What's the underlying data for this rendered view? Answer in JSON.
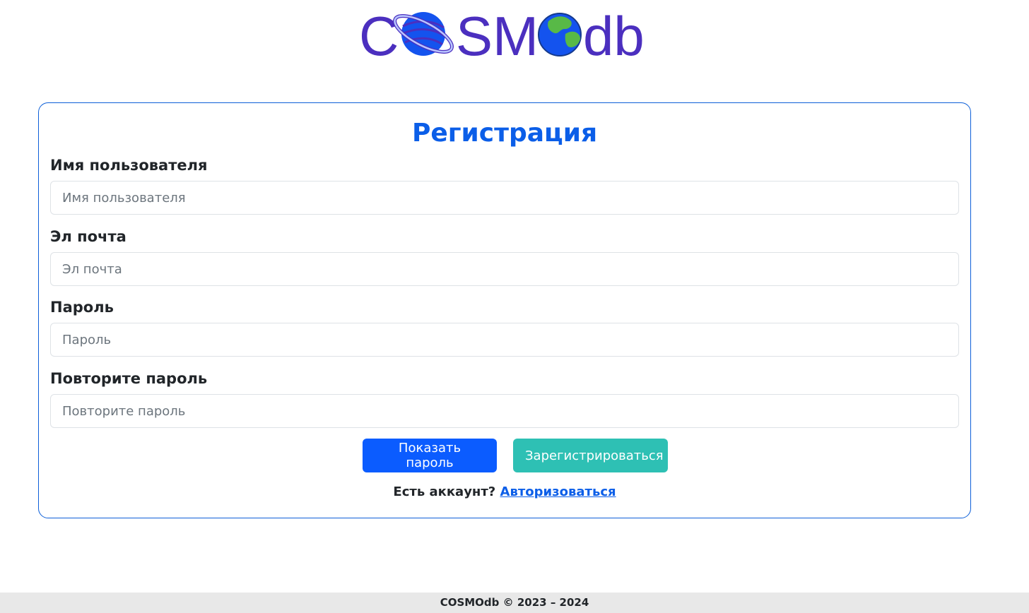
{
  "header": {
    "logo_text": "COSMOdb",
    "logo_color": "#4b2fbf",
    "logo_planet_color": "#1453ee",
    "logo_land_color": "#58b947"
  },
  "form": {
    "title": "Регистрация",
    "username_label": "Имя пользователя",
    "username_placeholder": "Имя пользователя",
    "email_label": "Эл почта",
    "email_placeholder": "Эл почта",
    "password_label": "Пароль",
    "password_placeholder": "Пароль",
    "repeat_label": "Повторите пароль",
    "repeat_placeholder": "Повторите пароль",
    "show_password_button": "Показать пароль",
    "register_button": "Зарегистрироваться",
    "account_prompt": "Есть аккаунт?",
    "login_link": "Авторизоваться",
    "accent_color": "#0b5ee8",
    "register_color": "#2ec0b4"
  },
  "footer": {
    "text": "COSMOdb © 2023 – 2024"
  }
}
